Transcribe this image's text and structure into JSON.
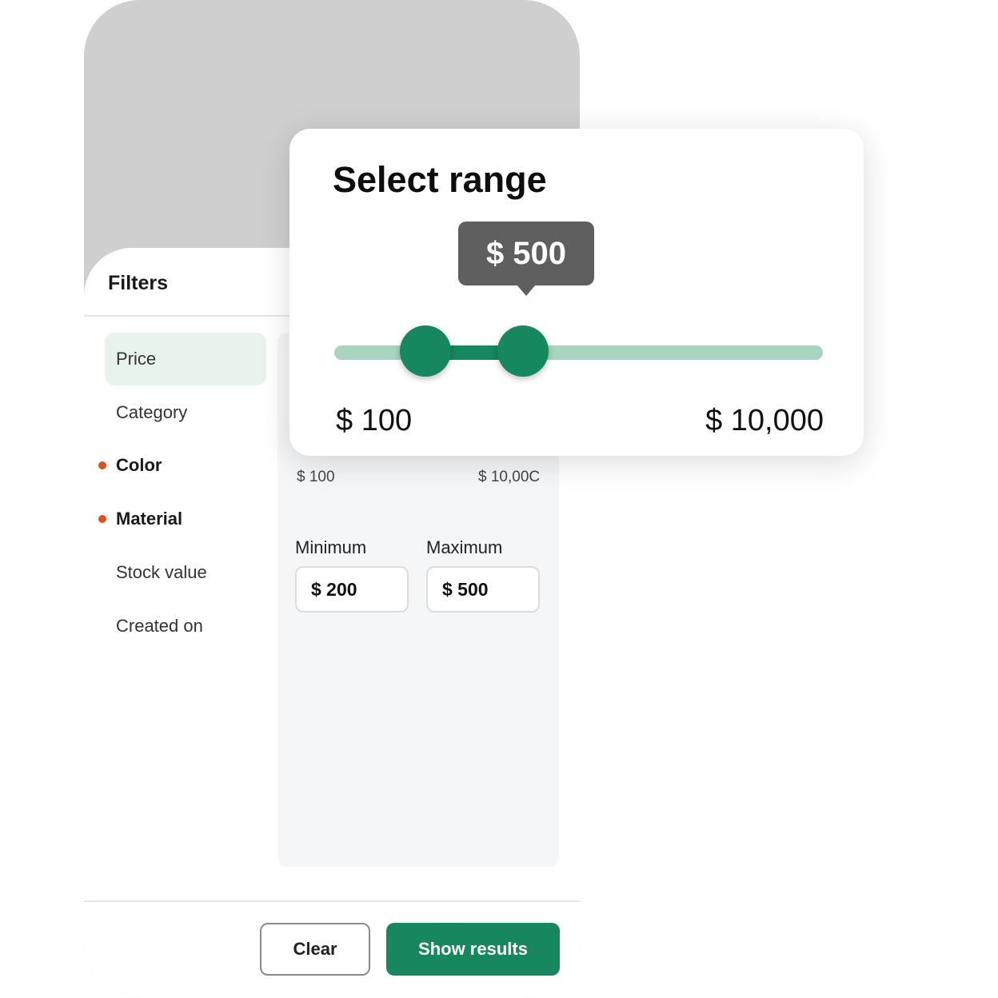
{
  "filters": {
    "title": "Filters",
    "items": [
      {
        "label": "Price",
        "active": true,
        "modified": false
      },
      {
        "label": "Category",
        "active": false,
        "modified": false
      },
      {
        "label": "Color",
        "active": false,
        "modified": true
      },
      {
        "label": "Material",
        "active": false,
        "modified": true
      },
      {
        "label": "Stock value",
        "active": false,
        "modified": false
      },
      {
        "label": "Created on",
        "active": false,
        "modified": false
      }
    ],
    "scale_min": "$ 100",
    "scale_max": "$ 10,00C",
    "minimum_label": "Minimum",
    "maximum_label": "Maximum",
    "minimum_value": "$ 200",
    "maximum_value": "$ 500",
    "clear_label": "Clear",
    "show_label": "Show results"
  },
  "range": {
    "title": "Select range",
    "tooltip": "$ 500",
    "min_label": "$ 100",
    "max_label": "$ 10,000",
    "scale_min": 100,
    "scale_max": 10000,
    "low_value": 200,
    "high_value": 500
  },
  "colors": {
    "accent": "#17875f",
    "track": "#a8d4c1",
    "modified_dot": "#d9531e",
    "active_bg": "#e8f3ee"
  }
}
